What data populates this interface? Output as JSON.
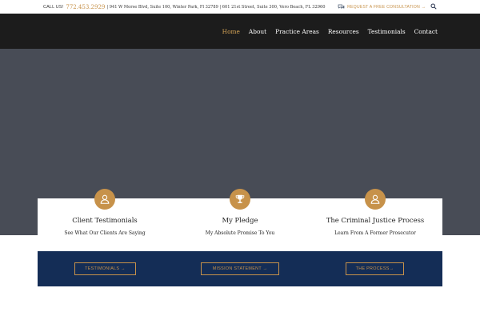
{
  "topbar": {
    "call_label": "CALL US!",
    "phone": "772.453.2929",
    "addresses": "| 941 W Morse Blvd, Suite 100, Winter Park, Fl 32789 | 601 21st Street, Suite 300, Vero Beach, FL 32960",
    "consult_label": "REQUEST A FREE CONSULTATION →",
    "chat_icon": "chat-bubbles-icon",
    "search_icon": "search-icon"
  },
  "nav": {
    "items": [
      "Home",
      "About",
      "Practice Areas",
      "Resources",
      "Testimonials",
      "Contact"
    ],
    "active": "Home"
  },
  "cards": [
    {
      "icon": "user-icon",
      "title": "Client Testimonials",
      "subtitle": "See What Our Clients Are Saying"
    },
    {
      "icon": "trophy-icon",
      "title": "My Pledge",
      "subtitle": "My Absolute Promise To You"
    },
    {
      "icon": "user-icon",
      "title": "The Criminal Justice Process",
      "subtitle": "Learn From A Former Prosecutor"
    }
  ],
  "cta": {
    "buttons": [
      "TESTIMONIALS →",
      "MISSION STATEMENT →",
      "THE PROCESS→"
    ]
  },
  "colors": {
    "accent": "#c7924a",
    "nav_bg": "#1c1c1c",
    "hero_bg": "#484c56",
    "cta_bg": "#142d56"
  }
}
